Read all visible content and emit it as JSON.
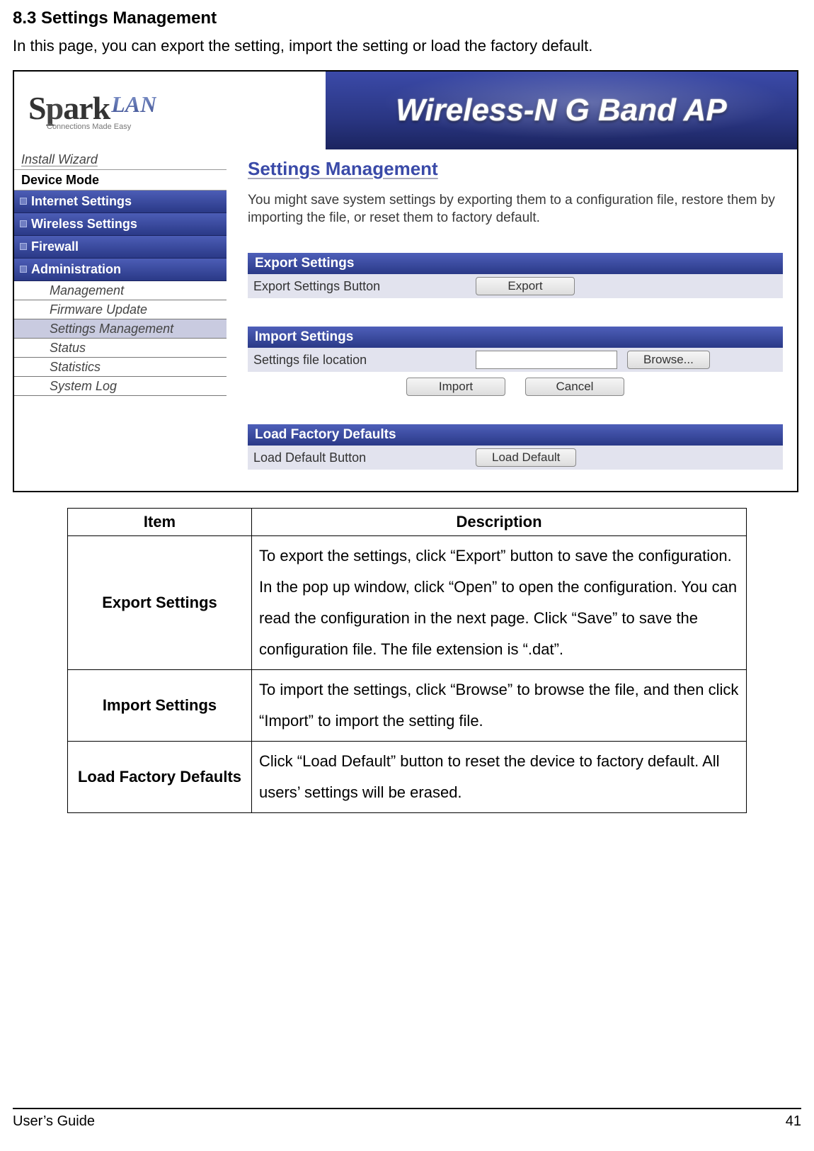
{
  "section": {
    "heading": "8.3 Settings Management",
    "intro": "In this page, you can export the setting, import the setting or load the factory default."
  },
  "banner": {
    "logo_prefix": "S",
    "logo_mid1": "p",
    "logo_mid2": "ark",
    "logo_suffix": "LAN",
    "logo_sub": "Connections Made Easy",
    "title": "Wireless-N G Band AP"
  },
  "sidebar": {
    "install": "Install Wizard",
    "device_mode": "Device Mode",
    "groups": {
      "internet": "Internet Settings",
      "wireless": "Wireless Settings",
      "firewall": "Firewall",
      "admin": "Administration"
    },
    "admin_items": [
      "Management",
      "Firmware Update",
      "Settings Management",
      "Status",
      "Statistics",
      "System Log"
    ],
    "admin_selected_index": 2
  },
  "content": {
    "title": "Settings Management",
    "desc": "You might save system settings by exporting them to a configuration file, restore them by importing the file, or reset them to factory default.",
    "export": {
      "header": "Export Settings",
      "row_label": "Export Settings Button",
      "button": "Export"
    },
    "import": {
      "header": "Import Settings",
      "row_label": "Settings file location",
      "browse": "Browse...",
      "import_btn": "Import",
      "cancel_btn": "Cancel"
    },
    "defaults": {
      "header": "Load Factory Defaults",
      "row_label": "Load Default Button",
      "button": "Load Default"
    }
  },
  "table": {
    "headers": {
      "item": "Item",
      "desc": "Description"
    },
    "rows": [
      {
        "item": "Export Settings",
        "desc": "To export the settings, click “Export” button to save the configuration. In the pop up window, click “Open” to open the configuration. You can read the configuration in the next page. Click “Save” to save the configuration file. The file extension is “.dat”."
      },
      {
        "item": "Import Settings",
        "desc": "To import the settings, click “Browse” to browse the file, and then click “Import” to import the setting file."
      },
      {
        "item": "Load Factory Defaults",
        "desc": "Click “Load Default” button to reset the device to factory default. All users’ settings will be erased."
      }
    ]
  },
  "footer": {
    "guide": "User’s Guide",
    "page": "41"
  }
}
